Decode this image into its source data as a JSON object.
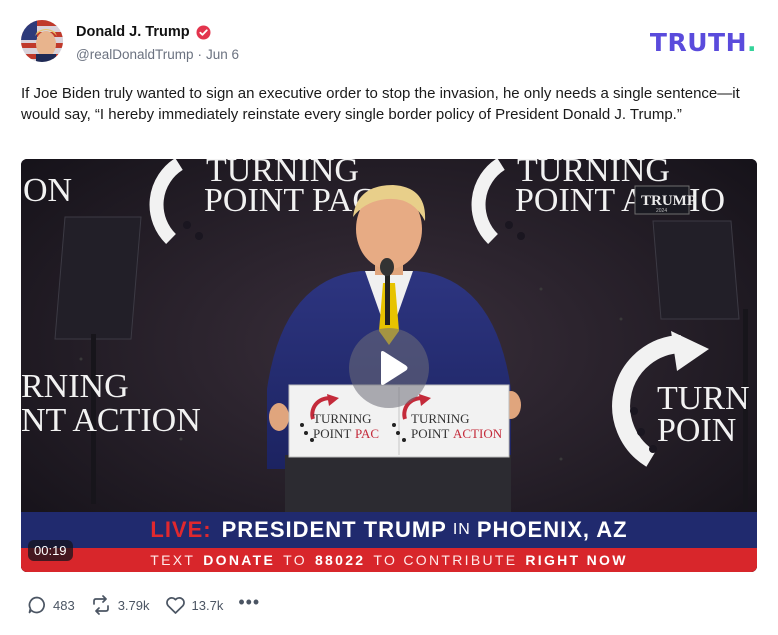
{
  "post": {
    "author_name": "Donald J. Trump",
    "handle": "@realDonaldTrump",
    "date": "Jun 6",
    "verified_icon": "verified-badge-icon",
    "brand_logo": "TRUTH",
    "text": "If Joe Biden truly wanted to sign an executive order to stop the invasion, he only needs a single sentence—it would say, “I hereby immediately reinstate every single border policy of President Donald J. Trump.”"
  },
  "video": {
    "duration": "00:19",
    "banner_left_top": "TURNING",
    "banner_left_bottom": "POINT PAC",
    "banner_right_top": "TURNING",
    "banner_right_bottom": "POINT ACTIO",
    "banner_far_left": "ON",
    "wall_left_1": "RNING",
    "wall_left_2": "NT ACTION",
    "wall_right_1": "TURN",
    "wall_right_2": "POIN",
    "logo_overlay": "TRUMP",
    "logo_overlay_year": "2024",
    "podium_left_1": "TURNING",
    "podium_left_2a": "POINT",
    "podium_left_2b": "PAC",
    "podium_right_1": "TURNING",
    "podium_right_2a": "POINT",
    "podium_right_2b": "ACTION",
    "lower_third": {
      "live": "LIVE:",
      "headline_a": "PRESIDENT TRUMP",
      "headline_in": "IN",
      "headline_b": "PHOENIX, AZ",
      "sub_1": "TEXT",
      "sub_2": "DONATE",
      "sub_3": "TO",
      "sub_4": "88022",
      "sub_5": "TO CONTRIBUTE",
      "sub_6": "RIGHT NOW"
    }
  },
  "actions": {
    "replies": "483",
    "retruths": "3.79k",
    "likes": "13.7k",
    "more": "•••"
  },
  "colors": {
    "brand": "#5a4bdc",
    "verified": "#e3344d",
    "banner_blue": "#202a6e",
    "banner_red": "#d8262b"
  }
}
